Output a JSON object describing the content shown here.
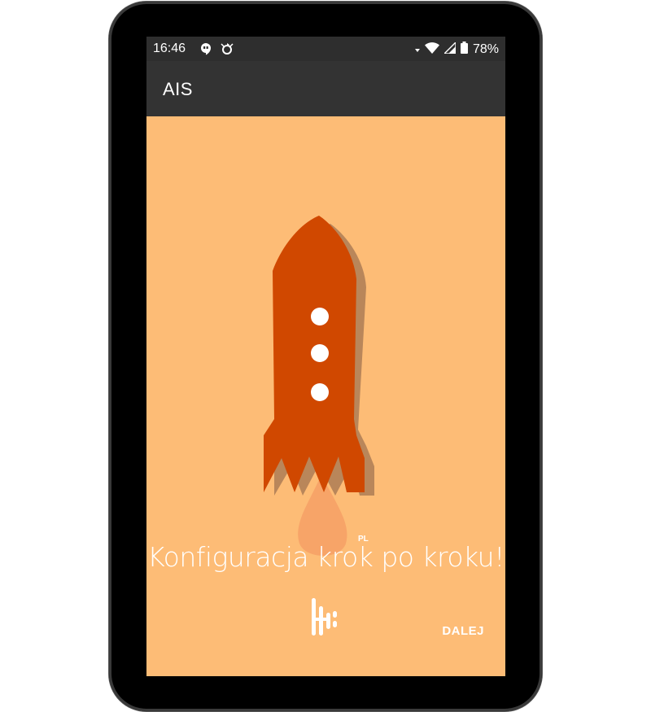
{
  "status_bar": {
    "time": "16:46",
    "battery_percent": "78%",
    "icons": [
      "hangouts-icon",
      "sync-icon",
      "data-arrow-icon",
      "wifi-icon",
      "cell-signal-icon",
      "battery-icon"
    ]
  },
  "app_bar": {
    "title": "AIS"
  },
  "main": {
    "headline": "Konfiguracja krok po kroku!",
    "rocket_badge": "PL",
    "next_button": "DALEJ"
  },
  "colors": {
    "background": "#fdbc76",
    "rocket": "#d04800",
    "rocket_shadow": "#b9865a",
    "flame": "#f7a468",
    "status_bar": "#2e2e2e",
    "app_bar": "#333333"
  }
}
